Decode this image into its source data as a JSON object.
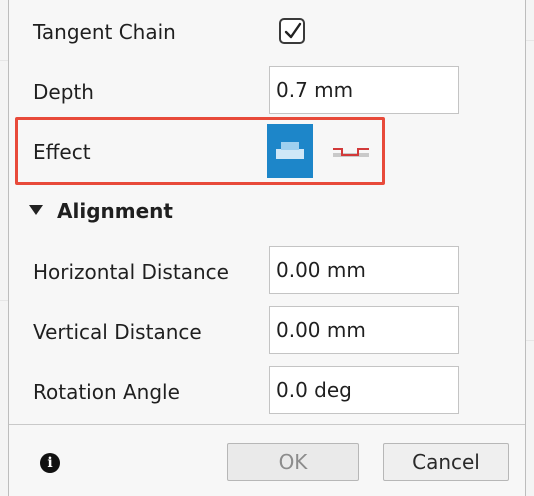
{
  "rows": {
    "tangent_chain": {
      "label": "Tangent Chain",
      "checked": true
    },
    "depth": {
      "label": "Depth",
      "value": "0.7 mm"
    },
    "effect": {
      "label": "Effect",
      "options": [
        "emboss-icon",
        "deboss-icon"
      ],
      "selected": "emboss-icon"
    }
  },
  "alignment": {
    "title": "Alignment",
    "expanded": true,
    "horizontal": {
      "label": "Horizontal Distance",
      "value": "0.00 mm"
    },
    "vertical": {
      "label": "Vertical Distance",
      "value": "0.00 mm"
    },
    "rotation": {
      "label": "Rotation Angle",
      "value": "0.0 deg"
    }
  },
  "footer": {
    "info_icon": "info-icon",
    "ok_label": "OK",
    "cancel_label": "Cancel"
  },
  "colors": {
    "accent": "#1d86c9",
    "highlight": "#e84a3a"
  }
}
